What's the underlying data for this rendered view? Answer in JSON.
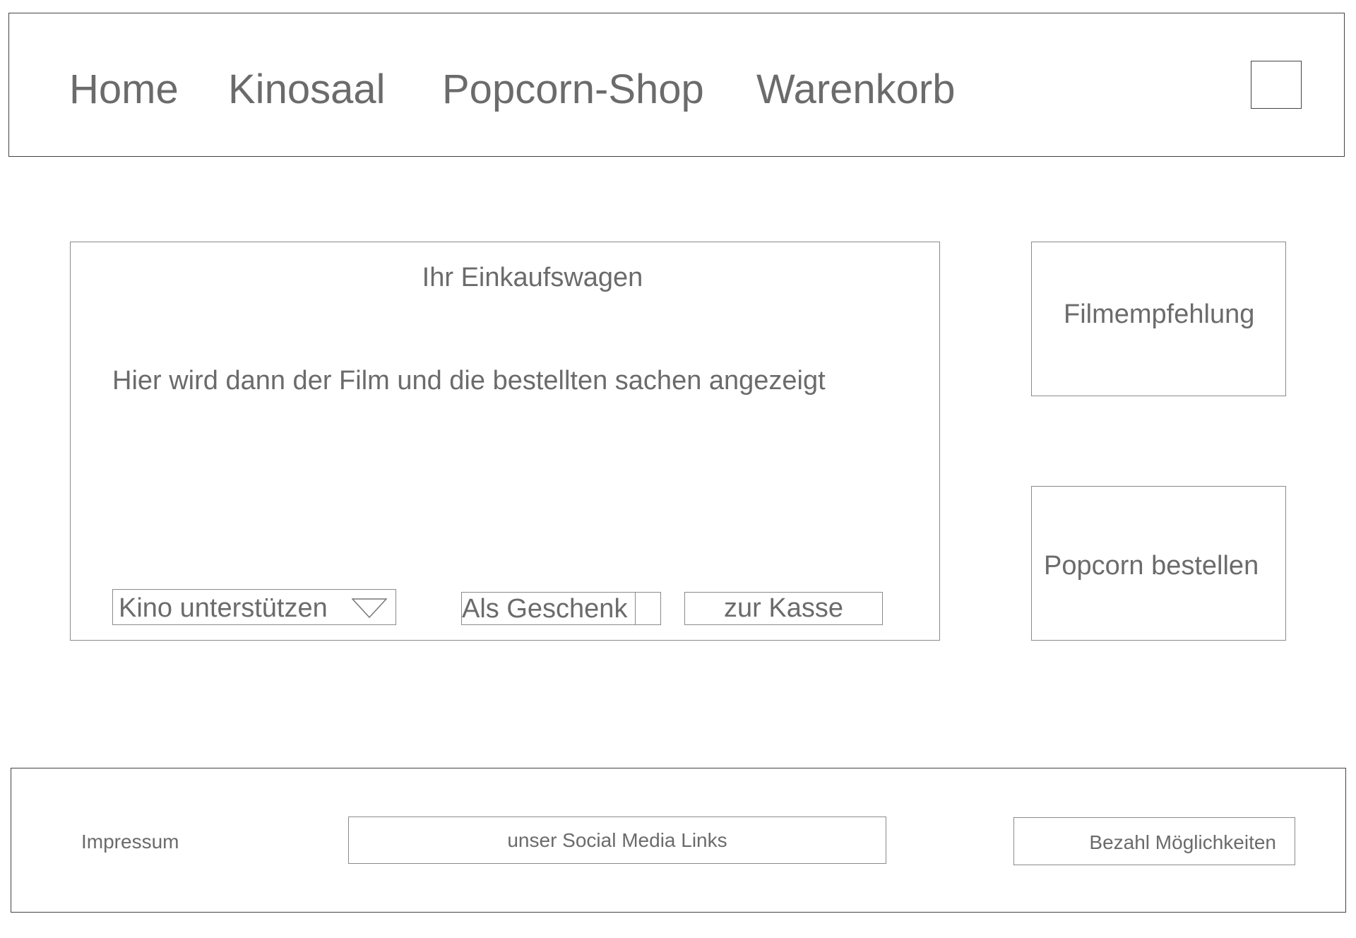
{
  "header": {
    "nav": [
      {
        "label": "Home"
      },
      {
        "label": "Kinosaal"
      },
      {
        "label": "Popcorn-Shop"
      },
      {
        "label": "Warenkorb"
      }
    ]
  },
  "cart": {
    "title": "Ihr Einkaufswagen",
    "body": "Hier wird dann der Film und die bestellten sachen angezeigt",
    "support_select": "Kino unterstützen",
    "gift_label": "Als Geschenk",
    "checkout_label": "zur Kasse"
  },
  "side": {
    "recommendation": "Filmempfehlung",
    "popcorn": "Popcorn bestellen"
  },
  "footer": {
    "impressum": "Impressum",
    "social": "unser Social Media Links",
    "payment": "Bezahl Möglichkeiten"
  },
  "colors": {
    "text": "#6b6b6b",
    "border": "#8a8a8a"
  }
}
